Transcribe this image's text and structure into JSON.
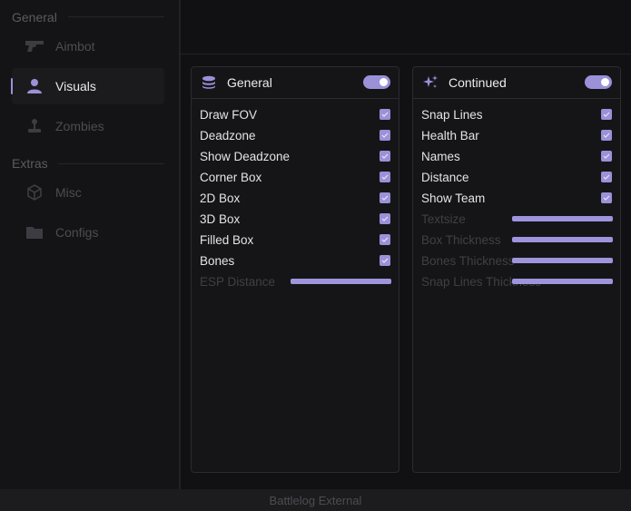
{
  "sidebar": {
    "sections": [
      {
        "label": "General"
      },
      {
        "label": "Extras"
      }
    ],
    "items": [
      {
        "label": "Aimbot",
        "icon": "gun-icon",
        "active": false
      },
      {
        "label": "Visuals",
        "icon": "user-icon",
        "active": true
      },
      {
        "label": "Zombies",
        "icon": "joystick-icon",
        "active": false
      },
      {
        "label": "Misc",
        "icon": "cube-icon",
        "active": false
      },
      {
        "label": "Configs",
        "icon": "folder-icon",
        "active": false
      }
    ]
  },
  "panels": [
    {
      "title": "General",
      "icon": "database-icon",
      "enabled": true,
      "checkboxes": [
        {
          "label": "Draw FOV",
          "checked": true
        },
        {
          "label": "Deadzone",
          "checked": true
        },
        {
          "label": "Show Deadzone",
          "checked": true
        },
        {
          "label": "Corner Box",
          "checked": true
        },
        {
          "label": "2D Box",
          "checked": true
        },
        {
          "label": "3D Box",
          "checked": true
        },
        {
          "label": "Filled Box",
          "checked": true
        },
        {
          "label": "Bones",
          "checked": true
        }
      ],
      "sliders": [
        {
          "label": "ESP Distance",
          "value": 1.0
        }
      ]
    },
    {
      "title": "Continued",
      "icon": "sparkles-icon",
      "enabled": true,
      "checkboxes": [
        {
          "label": "Snap Lines",
          "checked": true
        },
        {
          "label": "Health Bar",
          "checked": true
        },
        {
          "label": "Names",
          "checked": true
        },
        {
          "label": "Distance",
          "checked": true
        },
        {
          "label": "Show Team",
          "checked": true
        }
      ],
      "sliders": [
        {
          "label": "Textsize",
          "value": 1.0
        },
        {
          "label": "Box Thickness",
          "value": 1.0
        },
        {
          "label": "Bones Thickness",
          "value": 1.0
        },
        {
          "label": "Snap Lines Thickness",
          "value": 1.0
        }
      ]
    }
  ],
  "footer": {
    "text": "Battlelog External"
  },
  "colors": {
    "accent": "#9a91d8",
    "background": "#111113",
    "panel": "#151518",
    "dim_text": "#3f3f45"
  }
}
